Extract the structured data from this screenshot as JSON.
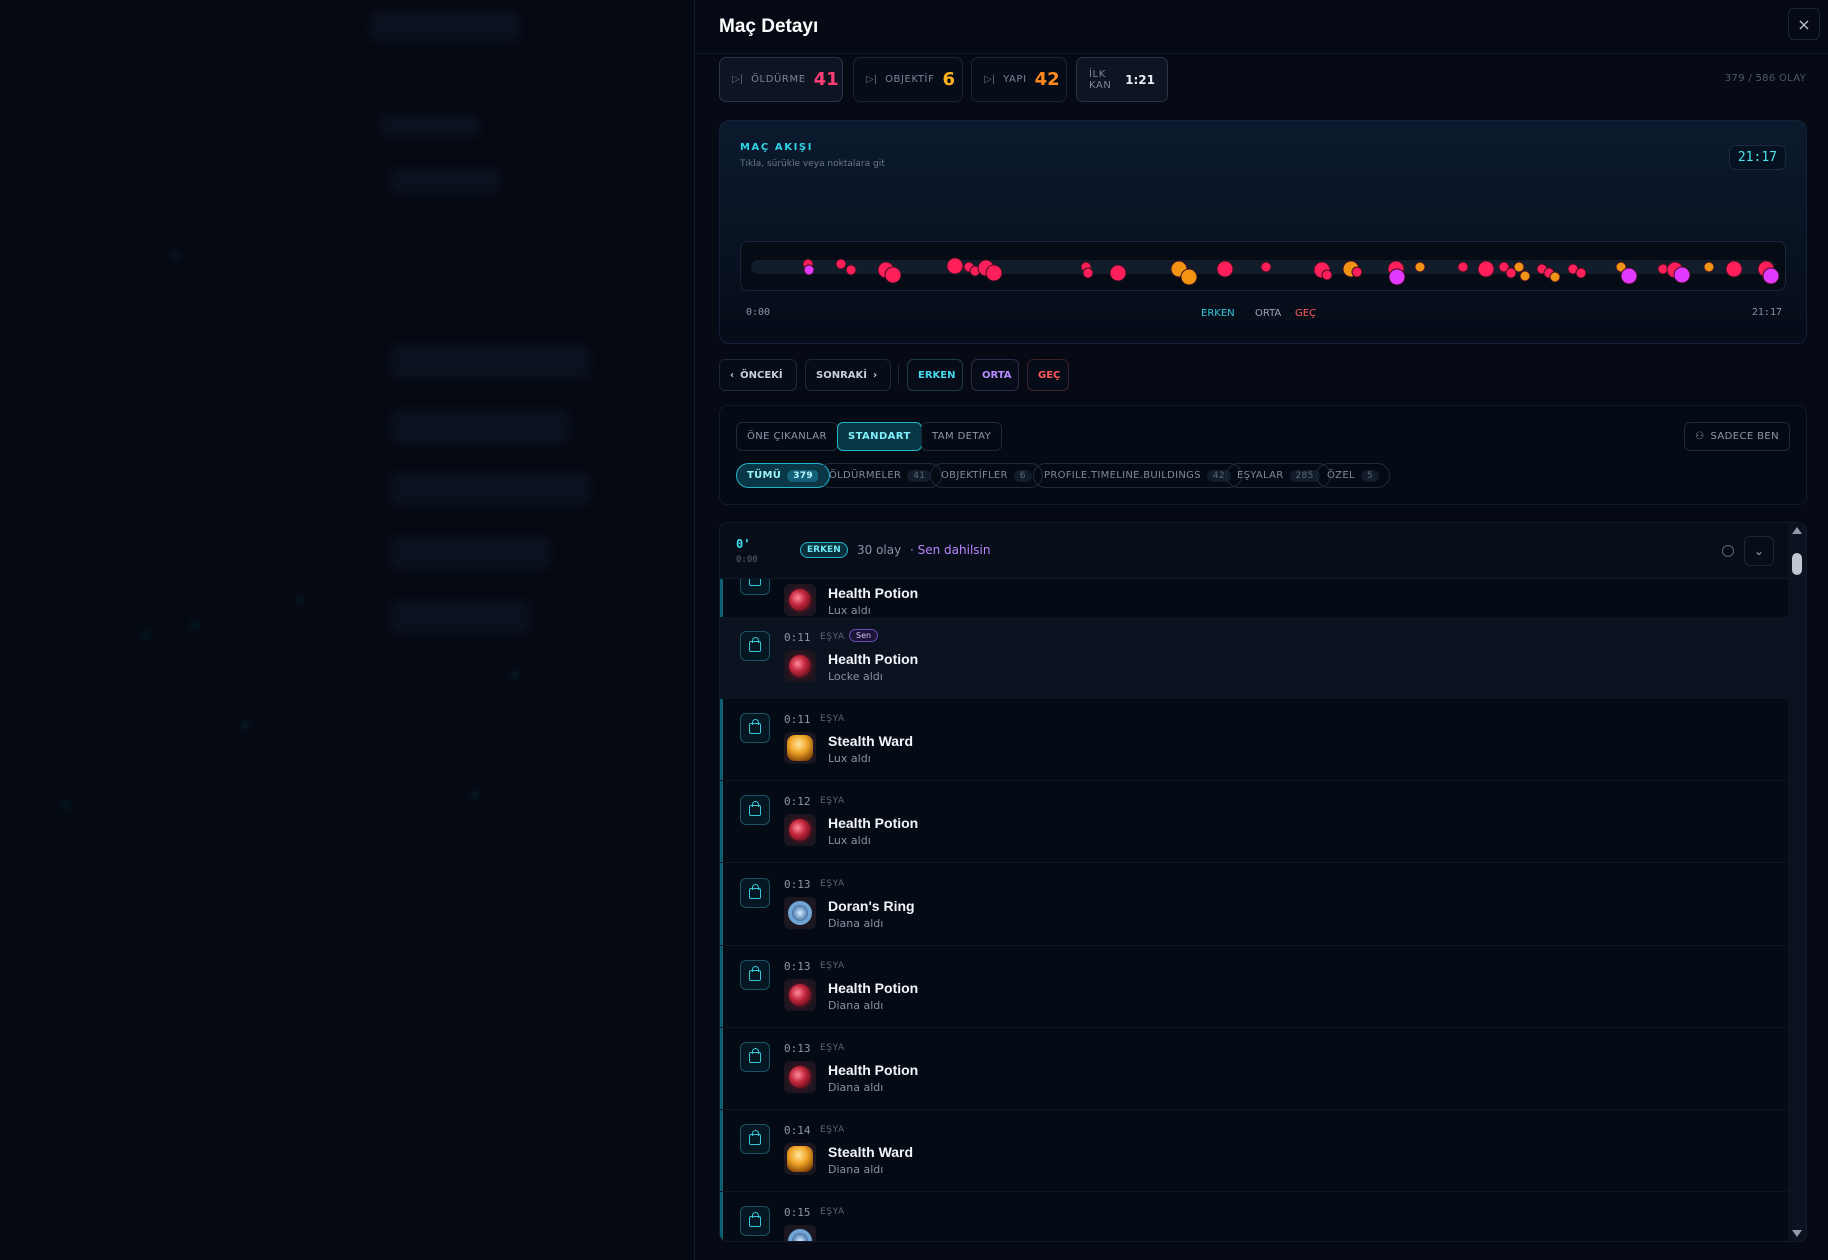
{
  "panel": {
    "title": "Maç Detayı",
    "close_icon": "×"
  },
  "stats": [
    {
      "label": "ÖLDÜRME",
      "value": "41",
      "color": "#ff3f73"
    },
    {
      "label": "OBJEKTİF",
      "value": "6",
      "color": "#ffb21f"
    },
    {
      "label": "YAPI",
      "value": "42",
      "color": "#ff8a1e"
    },
    {
      "label": "İLK KAN",
      "value": "1:21",
      "color": "#e6ecf5"
    }
  ],
  "events_count": "379 / 586 OLAY",
  "flow": {
    "title": "MAÇ AKIŞI",
    "subtitle": "Tıkla, sürükle veya noktalara git",
    "time": "21:17",
    "axis_start": "0:00",
    "axis_end": "21:17",
    "phases": [
      "ERKEN",
      "ORTA",
      "GEÇ"
    ],
    "event_colors": {
      "kill": "#ff1f5a",
      "objective": "#f39313",
      "you": "#e139ff"
    }
  },
  "nav": {
    "prev": "ÖNCEKİ",
    "next": "SONRAKİ",
    "phase_buttons": [
      {
        "label": "ERKEN",
        "color": "#44d9ec"
      },
      {
        "label": "ORTA",
        "color": "#b68cff"
      },
      {
        "label": "GEÇ",
        "color": "#ff5a5a"
      }
    ]
  },
  "views": [
    "ÖNE ÇIKANLAR",
    "STANDART",
    "TAM DETAY"
  ],
  "active_view": "STANDART",
  "me_button": "SADECE BEN",
  "filters": [
    {
      "label": "TÜMÜ",
      "count": "379"
    },
    {
      "label": "ÖLDÜRMELER",
      "count": "41"
    },
    {
      "label": "OBJEKTİFLER",
      "count": "6"
    },
    {
      "label": "PROFILE.TIMELINE.BUILDINGS",
      "count": "42"
    },
    {
      "label": "EŞYALAR",
      "count": "285"
    },
    {
      "label": "ÖZEL",
      "count": "5"
    }
  ],
  "group": {
    "minute": "0'",
    "time": "0:00",
    "phase": "ERKEN",
    "count": "30 olay",
    "you_text": "· Sen dahilsin"
  },
  "events": [
    {
      "time": "",
      "type": "",
      "you": "",
      "item": "Health Potion",
      "sub": "Lux aldı",
      "icon": "potion"
    },
    {
      "time": "0:11",
      "type": "EŞYA",
      "you": "Sen",
      "item": "Health Potion",
      "sub": "Locke aldı",
      "icon": "potion"
    },
    {
      "time": "0:11",
      "type": "EŞYA",
      "you": "",
      "item": "Stealth Ward",
      "sub": "Lux aldı",
      "icon": "ward"
    },
    {
      "time": "0:12",
      "type": "EŞYA",
      "you": "",
      "item": "Health Potion",
      "sub": "Lux aldı",
      "icon": "potion"
    },
    {
      "time": "0:13",
      "type": "EŞYA",
      "you": "",
      "item": "Doran's Ring",
      "sub": "Diana aldı",
      "icon": "ring"
    },
    {
      "time": "0:13",
      "type": "EŞYA",
      "you": "",
      "item": "Health Potion",
      "sub": "Diana aldı",
      "icon": "potion"
    },
    {
      "time": "0:13",
      "type": "EŞYA",
      "you": "",
      "item": "Health Potion",
      "sub": "Diana aldı",
      "icon": "potion"
    },
    {
      "time": "0:14",
      "type": "EŞYA",
      "you": "",
      "item": "Stealth Ward",
      "sub": "Diana aldı",
      "icon": "ward"
    },
    {
      "time": "0:15",
      "type": "EŞYA",
      "you": "",
      "item": "",
      "sub": "",
      "icon": "ring"
    }
  ]
}
